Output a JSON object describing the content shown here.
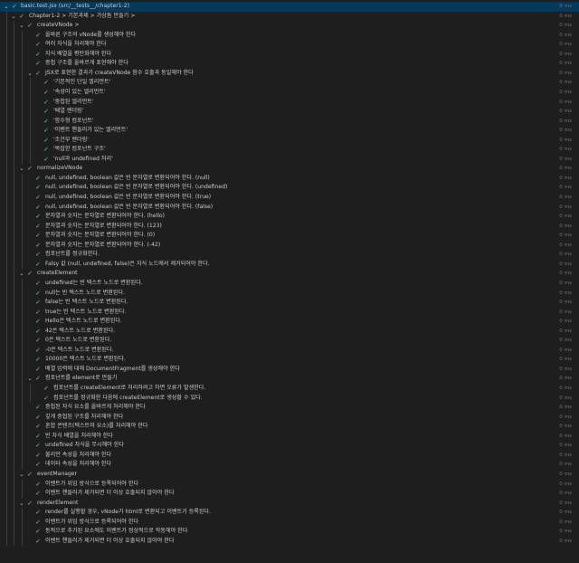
{
  "colors": {
    "background": "#1e1e1e",
    "pass": "#73c991",
    "selected_row": "#04395e",
    "duration": "#6f6f6f"
  },
  "icons": {
    "expanded": "chevron-down-icon",
    "passed": "check-icon"
  },
  "rows": [
    {
      "level": 0,
      "label": "basic.test.jsx (src/__tests__/chapter1-2)",
      "time": "0 ms"
    },
    {
      "level": 1,
      "label": "Chapter1-2 > 기본과제 > 가상돔 만들기 >",
      "time": "0 ms"
    },
    {
      "level": 2,
      "label": "createVNode >",
      "time": "0 ms"
    },
    {
      "level": 3,
      "label": "올바른 구조의 vNode를 생성해야 한다",
      "time": "0 ms"
    },
    {
      "level": 3,
      "label": "여러 자식을 처리해야 한다",
      "time": "0 ms"
    },
    {
      "level": 3,
      "label": "자식 배열을 평탄화해야 한다",
      "time": "0 ms"
    },
    {
      "level": 3,
      "label": "중첩 구조를 올바르게 표현해야 한다",
      "time": "0 ms"
    },
    {
      "level": 3,
      "label": "JSX로 표현한 결과가 createVNode 함수 호출과 동일해야 한다",
      "time": "0 ms"
    },
    {
      "level": 4,
      "label": "'기본적인 단일 엘리먼트'",
      "time": "0 ms"
    },
    {
      "level": 4,
      "label": "'속성이 있는 엘리먼트'",
      "time": "0 ms"
    },
    {
      "level": 4,
      "label": "'중첩된 엘리먼트'",
      "time": "0 ms"
    },
    {
      "level": 4,
      "label": "'배열 렌더링'",
      "time": "0 ms"
    },
    {
      "level": 4,
      "label": "'함수형 컴포넌트'",
      "time": "0 ms"
    },
    {
      "level": 4,
      "label": "'이벤트 핸들러가 있는 엘리먼트'",
      "time": "0 ms"
    },
    {
      "level": 4,
      "label": "'조건부 렌더링'",
      "time": "0 ms"
    },
    {
      "level": 4,
      "label": "'복잡한 컴포넌트 구조'",
      "time": "0 ms"
    },
    {
      "level": 4,
      "label": "'null과 undefined 처리'",
      "time": "0 ms"
    },
    {
      "level": 2,
      "label": "normalizeVNode",
      "time": "0 ms"
    },
    {
      "level": 3,
      "label": "null, undefined, boolean 값은 빈 문자열로 변환되어야 한다. (null)",
      "time": "0 ms"
    },
    {
      "level": 3,
      "label": "null, undefined, boolean 값은 빈 문자열로 변환되어야 한다. (undefined)",
      "time": "0 ms"
    },
    {
      "level": 3,
      "label": "null, undefined, boolean 값은 빈 문자열로 변환되어야 한다. (true)",
      "time": "0 ms"
    },
    {
      "level": 3,
      "label": "null, undefined, boolean 값은 빈 문자열로 변환되어야 한다. (false)",
      "time": "0 ms"
    },
    {
      "level": 3,
      "label": "문자열과 숫자는 문자열로 변환되어야 한다. (hello)",
      "time": "0 ms"
    },
    {
      "level": 3,
      "label": "문자열과 숫자는 문자열로 변환되어야 한다. (123)",
      "time": "0 ms"
    },
    {
      "level": 3,
      "label": "문자열과 숫자는 문자열로 변환되어야 한다. (0)",
      "time": "0 ms"
    },
    {
      "level": 3,
      "label": "문자열과 숫자는 문자열로 변환되어야 한다. (-42)",
      "time": "0 ms"
    },
    {
      "level": 3,
      "label": "컴포넌트를 정규화한다.",
      "time": "0 ms"
    },
    {
      "level": 3,
      "label": "Falsy 값 (null, undefined, false)은 자식 노드에서 제거되어야 한다.",
      "time": "0 ms"
    },
    {
      "level": 2,
      "label": "createElement",
      "time": "0 ms"
    },
    {
      "level": 3,
      "label": "undefined는 빈 텍스트 노드로 변환된다.",
      "time": "0 ms"
    },
    {
      "level": 3,
      "label": "null는 빈 텍스트 노드로 변환된다.",
      "time": "0 ms"
    },
    {
      "level": 3,
      "label": "false는 빈 텍스트 노드로 변환된다.",
      "time": "0 ms"
    },
    {
      "level": 3,
      "label": "true는 빈 텍스트 노드로 변환된다.",
      "time": "0 ms"
    },
    {
      "level": 3,
      "label": "Hello은 텍스트 노드로 변환된다.",
      "time": "0 ms"
    },
    {
      "level": 3,
      "label": "42은 텍스트 노드로 변환된다.",
      "time": "0 ms"
    },
    {
      "level": 3,
      "label": "0은 텍스트 노드로 변환된다.",
      "time": "0 ms"
    },
    {
      "level": 3,
      "label": "-0은 텍스트 노드로 변환된다.",
      "time": "0 ms"
    },
    {
      "level": 3,
      "label": "10000은 텍스트 노드로 변환된다.",
      "time": "0 ms"
    },
    {
      "level": 3,
      "label": "배열 입력에 대해 DocumentFragment를 생성해야 한다",
      "time": "0 ms"
    },
    {
      "level": 3,
      "label": "컴포넌트를 element로 만들기",
      "time": "0 ms"
    },
    {
      "level": 4,
      "label": "컴포넌트를 createElement로 처리하려고 하면 오류가 발생한다.",
      "time": "0 ms"
    },
    {
      "level": 4,
      "label": "컴포넌트를 정규화한 다음에 createElement로 생성할 수 있다.",
      "time": "0 ms"
    },
    {
      "level": 3,
      "label": "중첩된 자식 요소를 올바르게 처리해야 한다",
      "time": "0 ms"
    },
    {
      "level": 3,
      "label": "깊게 중첩된 구조를 처리해야 한다",
      "time": "0 ms"
    },
    {
      "level": 3,
      "label": "혼합 콘텐츠(텍스트와 요소)를 처리해야 한다",
      "time": "0 ms"
    },
    {
      "level": 3,
      "label": "빈 자식 배열을 처리해야 한다",
      "time": "0 ms"
    },
    {
      "level": 3,
      "label": "undefined 자식을 무시해야 한다",
      "time": "0 ms"
    },
    {
      "level": 3,
      "label": "불리언 속성을 처리해야 한다",
      "time": "0 ms"
    },
    {
      "level": 3,
      "label": "데이터 속성을 처리해야 한다",
      "time": "0 ms"
    },
    {
      "level": 2,
      "label": "eventManager",
      "time": "0 ms"
    },
    {
      "level": 3,
      "label": "이벤트가 위임 방식으로 등록되어야 한다",
      "time": "0 ms"
    },
    {
      "level": 3,
      "label": "이벤트 핸들러가 제거되면 더 이상 호출되지 않아야 한다",
      "time": "0 ms"
    },
    {
      "level": 2,
      "label": "renderElement",
      "time": "0 ms"
    },
    {
      "level": 3,
      "label": "render를 실행할 경우, vNode가 html로 변환되고 이벤트가 등록된다.",
      "time": "0 ms"
    },
    {
      "level": 3,
      "label": "이벤트가 위임 방식으로 등록되어야 한다",
      "time": "0 ms"
    },
    {
      "level": 3,
      "label": "동적으로 추가된 요소에도 이벤트가 정상적으로 작동해야 한다",
      "time": "0 ms"
    },
    {
      "level": 3,
      "label": "이벤트 핸들러가 제거되면 더 이상 호출되지 않아야 한다",
      "time": "0 ms"
    }
  ]
}
